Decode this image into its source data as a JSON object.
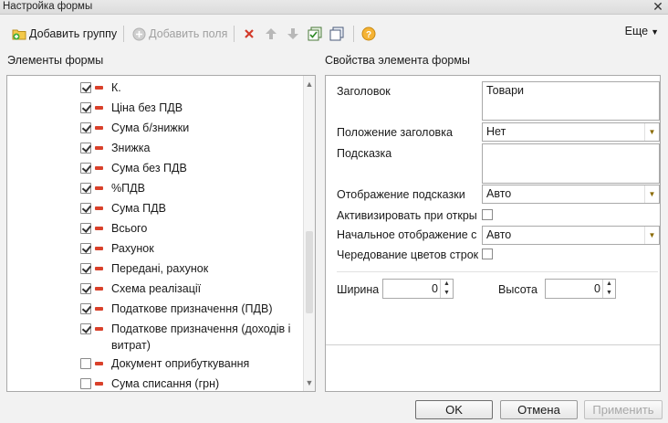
{
  "window": {
    "title": "Настройка формы"
  },
  "toolbar": {
    "add_group": "Добавить группу",
    "add_fields": "Добавить поля",
    "more": "Еще"
  },
  "left": {
    "header": "Элементы формы",
    "items": [
      {
        "label": "К.",
        "checked": true
      },
      {
        "label": "Ціна без ПДВ",
        "checked": true
      },
      {
        "label": "Сума б/знижки",
        "checked": true
      },
      {
        "label": "Знижка",
        "checked": true
      },
      {
        "label": "Сума без ПДВ",
        "checked": true
      },
      {
        "label": "%ПДВ",
        "checked": true
      },
      {
        "label": "Сума ПДВ",
        "checked": true
      },
      {
        "label": "Всього",
        "checked": true
      },
      {
        "label": "Рахунок",
        "checked": true
      },
      {
        "label": "Передані, рахунок",
        "checked": true
      },
      {
        "label": "Схема реалізації",
        "checked": true
      },
      {
        "label": "Податкове призначення (ПДВ)",
        "checked": true
      },
      {
        "label": "Податкове призначення (доходів і витрат)",
        "checked": true
      },
      {
        "label": "Документ оприбуткування",
        "checked": false
      },
      {
        "label": "Сума списання (грн)",
        "checked": false
      }
    ]
  },
  "right": {
    "header": "Свойства элемента формы",
    "title_label": "Заголовок",
    "title_value": "Товари",
    "title_position_label": "Положение заголовка",
    "title_position_value": "Нет",
    "tooltip_label": "Подсказка",
    "tooltip_value": "",
    "tooltip_display_label": "Отображение подсказки",
    "tooltip_display_value": "Авто",
    "activate_label": "Активизировать при откры",
    "initial_display_label": "Начальное отображение с",
    "initial_display_value": "Авто",
    "alternate_rows_label": "Чередование цветов строк",
    "width_label": "Ширина",
    "width_value": "0",
    "height_label": "Высота",
    "height_value": "0"
  },
  "buttons": {
    "ok": "OK",
    "cancel": "Отмена",
    "apply": "Применить"
  }
}
